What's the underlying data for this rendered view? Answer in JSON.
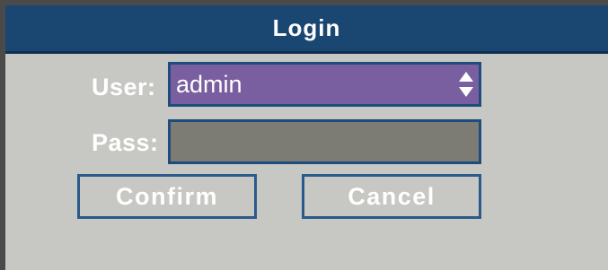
{
  "dialog": {
    "title": "Login"
  },
  "form": {
    "user_label": "User:",
    "user_value": "admin",
    "pass_label": "Pass:",
    "pass_value": ""
  },
  "buttons": {
    "confirm_label": "Confirm",
    "cancel_label": "Cancel"
  },
  "icons": {
    "user_select_icon": "updown-arrows-icon"
  },
  "colors": {
    "titlebar": "#1a4672",
    "panel": "#c7c7c4",
    "selected_field": "#7a5fa0",
    "password_field": "#7d7c74",
    "border": "#1d4d7d",
    "text": "#ffffff"
  }
}
